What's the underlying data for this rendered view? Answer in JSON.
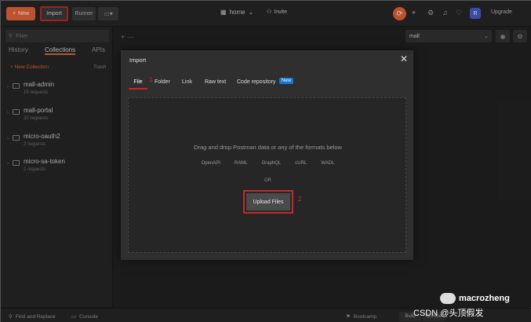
{
  "topbar": {
    "new_label": "New",
    "import_label": "Import",
    "runner_label": "Runner",
    "workspace": "home",
    "invite": "Invite",
    "upgrade": "Upgrade",
    "avatar_initial": "R"
  },
  "sidebar": {
    "filter_placeholder": "Filter",
    "tabs": [
      "History",
      "Collections",
      "APIs"
    ],
    "new_collection": "+ New Collection",
    "trash": "Trash",
    "collections": [
      {
        "name": "mall-admin",
        "count": "15 requests"
      },
      {
        "name": "mall-portal",
        "count": "30 requests"
      },
      {
        "name": "micro-oauth2",
        "count": "3 requests"
      },
      {
        "name": "micro-sa-token",
        "count": "2 requests"
      }
    ]
  },
  "main": {
    "environment": "mall"
  },
  "modal": {
    "title": "Import",
    "close": "✕",
    "tabs": [
      "File",
      "Folder",
      "Link",
      "Raw text",
      "Code repository"
    ],
    "new_badge": "New",
    "marker_1": "1",
    "drop_text": "Drag and drop Postman data or any of the formats below",
    "formats": [
      "OpenAPI",
      "RAML",
      "GraphQL",
      "cURL",
      "WADL"
    ],
    "or": "OR",
    "upload_label": "Upload Files",
    "marker_2": "2"
  },
  "bottombar": {
    "find_replace": "Find and Replace",
    "console": "Console",
    "bootcamp": "Bootcamp",
    "build": "Build",
    "browse": "Browse"
  },
  "watermark": {
    "handle": "macrozheng",
    "csdn": "CSDN @头顶假发"
  }
}
